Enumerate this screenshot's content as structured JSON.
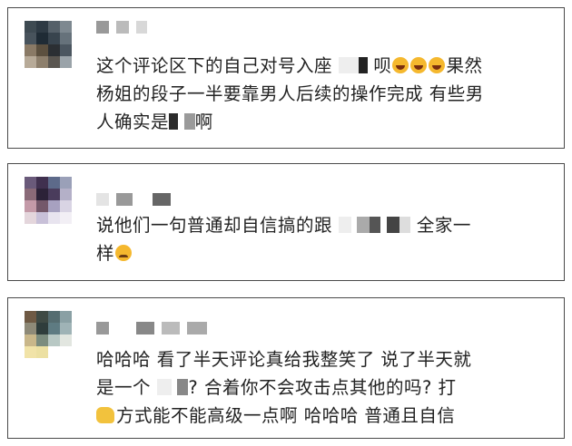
{
  "comments": [
    {
      "text_parts": [
        "这个评论区下的自己对号入座",
        "呗",
        "果然",
        "杨姐的段子一半要靠男人后续的操作完成 有些男",
        "人确实是",
        "啊"
      ],
      "emoji_icons": [
        "laughing-tears-emoji",
        "laughing-tears-emoji",
        "laughing-tears-emoji"
      ]
    },
    {
      "text_parts": [
        "说他们一句普通却自信搞的跟",
        "全家一",
        "样"
      ],
      "emoji_icons": [
        "pleading-face-emoji"
      ]
    },
    {
      "text_parts": [
        "哈哈哈 看了半天评论真给我整笑了 说了半天就",
        "是一个",
        "? 合着你不会攻击点其他的吗? 打",
        "方式能不能高级一点啊 哈哈哈 普通且自信"
      ],
      "emoji_icons": [
        "fist-emoji"
      ]
    }
  ],
  "colors": {
    "card_border": "#4a4a4a",
    "text": "#222222",
    "censor": "#2b2b2b"
  }
}
